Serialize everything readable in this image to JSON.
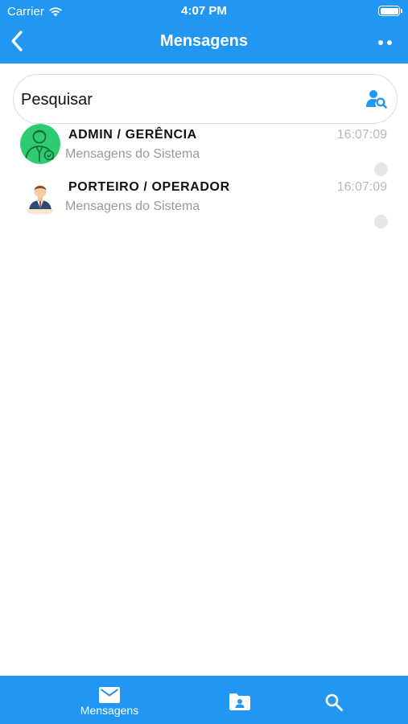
{
  "status_bar": {
    "carrier": "Carrier",
    "time": "4:07 PM"
  },
  "header": {
    "title": "Mensagens"
  },
  "search": {
    "placeholder": "Pesquisar"
  },
  "conversations": [
    {
      "name": "ADMIN / GERÊNCIA",
      "subtitle": "Mensagens do Sistema",
      "time": "16:07:09",
      "avatar_color": "#2ecc71"
    },
    {
      "name": "PORTEIRO / OPERADOR",
      "subtitle": "Mensagens do Sistema",
      "time": "16:07:09",
      "avatar_color": "#ffffff"
    }
  ],
  "tabbar": {
    "tabs": [
      {
        "label": "Mensagens",
        "icon": "mail-icon"
      },
      {
        "label": "",
        "icon": "contacts-folder-icon"
      },
      {
        "label": "",
        "icon": "search-icon"
      }
    ]
  },
  "colors": {
    "primary": "#2196f3",
    "unread_dot": "#e6e6e6",
    "muted_text": "#9a9a9a"
  }
}
